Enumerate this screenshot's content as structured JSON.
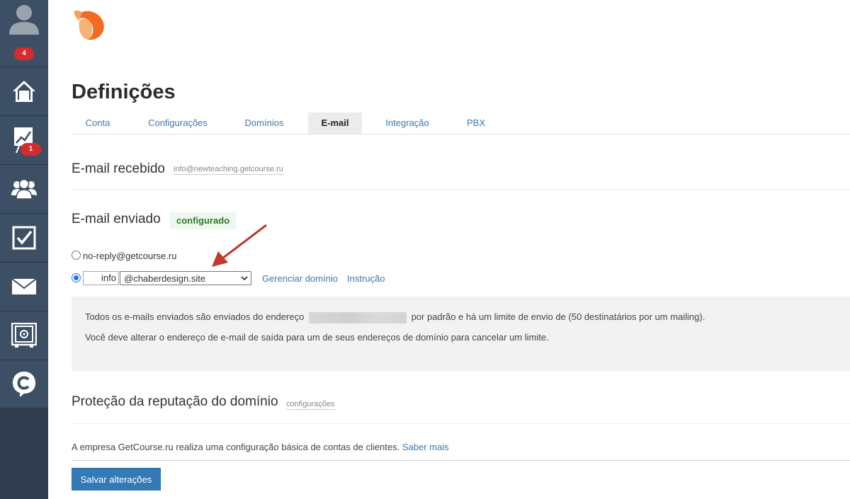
{
  "sidebar": {
    "items": [
      {
        "icon": "user-avatar-icon",
        "badge": "4"
      },
      {
        "icon": "home-icon",
        "badge": ""
      },
      {
        "icon": "chart-board-icon",
        "badge": "1"
      },
      {
        "icon": "users-group-icon",
        "badge": ""
      },
      {
        "icon": "tasks-checkbox-icon",
        "badge": ""
      },
      {
        "icon": "mail-icon",
        "badge": ""
      },
      {
        "icon": "safe-icon",
        "badge": ""
      },
      {
        "icon": "chat-logo-icon",
        "badge": ""
      }
    ]
  },
  "page": {
    "title": "Definições"
  },
  "tabs": [
    {
      "label": "Conta",
      "active": false
    },
    {
      "label": "Configurações",
      "active": false
    },
    {
      "label": "Domínios",
      "active": false
    },
    {
      "label": "E-mail",
      "active": true
    },
    {
      "label": "Integração",
      "active": false
    },
    {
      "label": "PBX",
      "active": false
    }
  ],
  "received": {
    "title": "E-mail recebido",
    "address": "info@newteaching.getcourse.ru"
  },
  "sent": {
    "title": "E-mail enviado",
    "status": "configurado",
    "option_default": "no-reply@getcourse.ru",
    "local_part": "info",
    "domain_selected": "@chaberdesign.site",
    "manage_domain_link": "Gerenciar domínio",
    "instruction_link": "Instrução"
  },
  "info_box": {
    "line1_before": "Todos os e-mails enviados são enviados do endereço",
    "line1_after": "por padrão e há um limite de envio de (50 destinatários por um mailing).",
    "line2": "Você deve alterar o endereço de e-mail de saída para um de seus endereços de domínio para cancelar um limite."
  },
  "reputation": {
    "title": "Proteção da reputação do domínio",
    "settings_link": "configurações"
  },
  "footer": {
    "text": "A empresa GetCourse.ru realiza uma configuração básica de contas de clientes.",
    "link": "Saber mais",
    "save_button": "Salvar alterações"
  },
  "colors": {
    "sidebar_bg": "#3d4f65",
    "accent": "#337ab7",
    "link": "#3a78b0",
    "badge_red": "#d52b2b",
    "status_green": "#2d7a2d",
    "arrow": "#c0392b"
  }
}
